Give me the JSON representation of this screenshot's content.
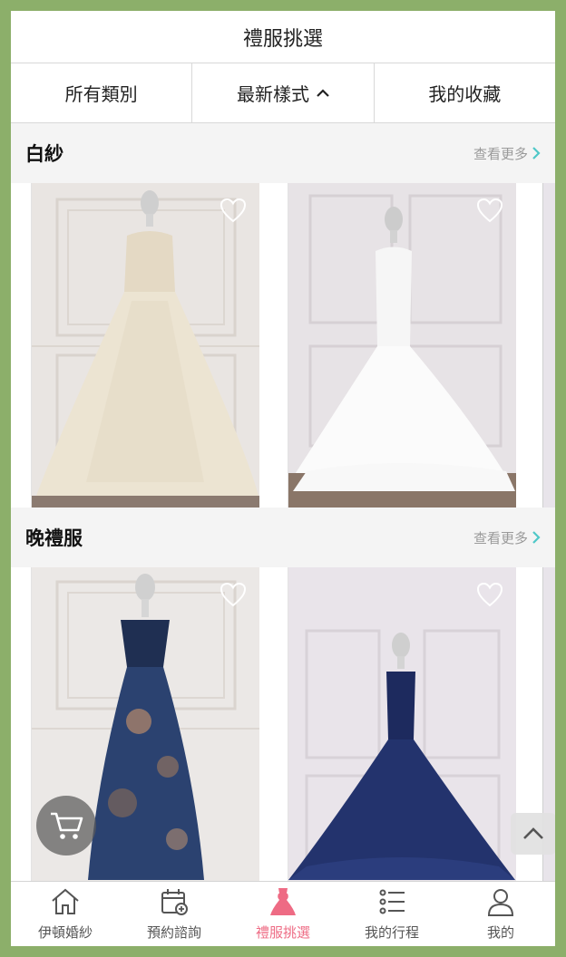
{
  "header": {
    "title": "禮服挑選"
  },
  "filters": [
    {
      "label": "所有類別"
    },
    {
      "label": "最新樣式"
    },
    {
      "label": "我的收藏"
    }
  ],
  "sections": [
    {
      "title": "白紗",
      "more": "查看更多"
    },
    {
      "title": "晚禮服",
      "more": "查看更多"
    }
  ],
  "tabs": [
    {
      "label": "伊頓婚紗",
      "icon": "home-icon"
    },
    {
      "label": "預約諮詢",
      "icon": "calendar-plus-icon"
    },
    {
      "label": "禮服挑選",
      "icon": "dress-icon"
    },
    {
      "label": "我的行程",
      "icon": "list-icon"
    },
    {
      "label": "我的",
      "icon": "user-icon"
    }
  ],
  "colors": {
    "active_tab": "#ee6b84",
    "accent_arrow": "#4fc8c8",
    "border_frame": "#8caf6a"
  }
}
